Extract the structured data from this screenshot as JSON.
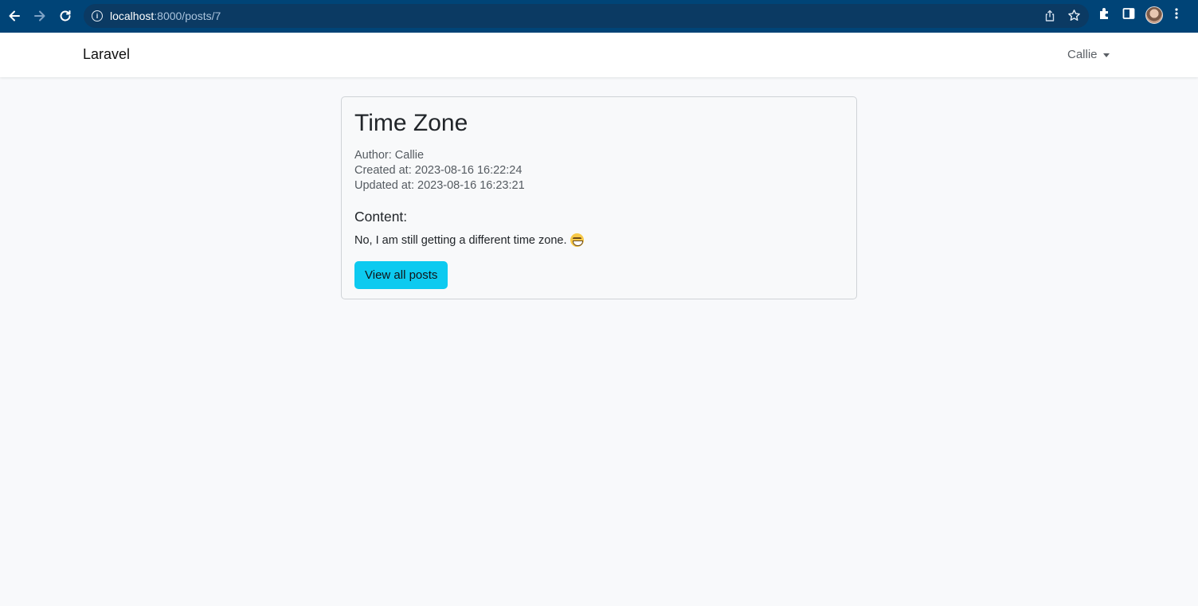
{
  "browser": {
    "url_host": "localhost",
    "url_path": ":8000/posts/7"
  },
  "navbar": {
    "brand": "Laravel",
    "user_name": "Callie"
  },
  "post": {
    "title": "Time Zone",
    "author": "Author: Callie",
    "created_at": "Created at: 2023-08-16 16:22:24",
    "updated_at": "Updated at: 2023-08-16 16:23:21",
    "content_heading": "Content:",
    "content": "No, I am still getting a different time zone.",
    "button_label": "View all posts"
  },
  "colors": {
    "browser_bar": "#004477",
    "button": "#0dcaf0",
    "page_background": "#f8f9fb"
  }
}
